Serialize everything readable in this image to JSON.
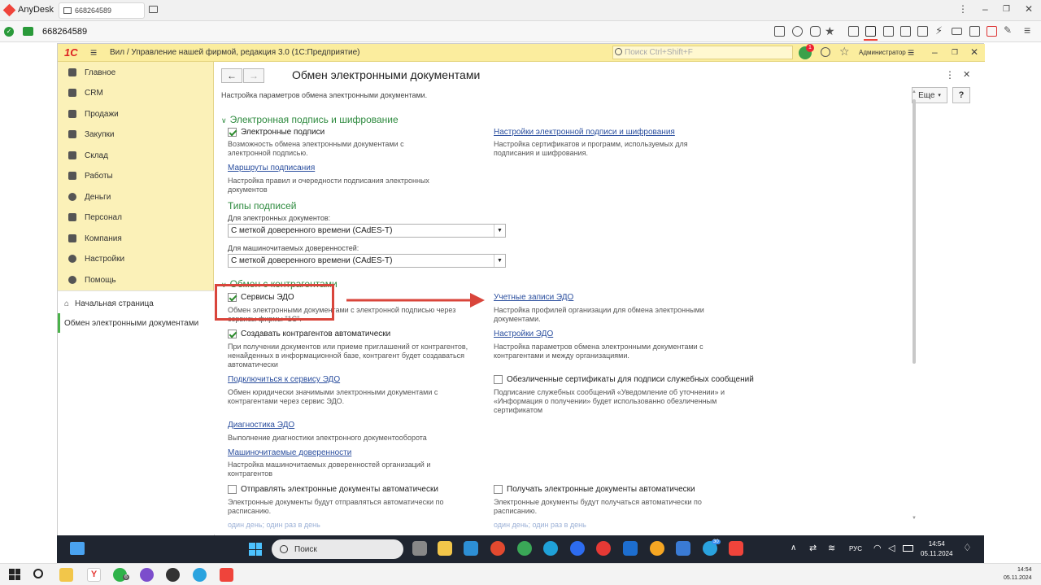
{
  "anydesk": {
    "app_name": "AnyDesk",
    "tab_id": "668264589",
    "session_id": "668264589",
    "accent_color": "#ef443b"
  },
  "onec": {
    "logo": "1С",
    "window_title": "Вил / Управление нашей фирмой, редакция 3.0  (1С:Предприятие)",
    "search_placeholder": "Поиск Ctrl+Shift+F",
    "notification_count": "1",
    "user": "Администратор"
  },
  "sidebar": {
    "items": [
      {
        "label": "Главное",
        "icon": "menu-icon"
      },
      {
        "label": "CRM",
        "icon": "crm-icon"
      },
      {
        "label": "Продажи",
        "icon": "sales-icon"
      },
      {
        "label": "Закупки",
        "icon": "cart-icon"
      },
      {
        "label": "Склад",
        "icon": "warehouse-icon"
      },
      {
        "label": "Работы",
        "icon": "tools-icon"
      },
      {
        "label": "Деньги",
        "icon": "money-icon"
      },
      {
        "label": "Персонал",
        "icon": "people-icon"
      },
      {
        "label": "Компания",
        "icon": "flag-icon"
      },
      {
        "label": "Настройки",
        "icon": "gear-icon"
      },
      {
        "label": "Помощь",
        "icon": "help-icon"
      }
    ],
    "home_link": "Начальная страница",
    "active_link": "Обмен электронными документами"
  },
  "form": {
    "title": "Обмен электронными документами",
    "description": "Настройка параметров обмена электронными документами.",
    "more_label": "Еще",
    "help_label": "?",
    "section1": {
      "title": "Электронная подпись и шифрование",
      "esig_checkbox": "Электронные подписи",
      "esig_desc": "Возможность обмена электронными документами с электронной подписью.",
      "esig_settings_link": "Настройки электронной подписи и шифрования",
      "esig_settings_desc": "Настройка сертификатов и программ, используемых для подписания и шифрования.",
      "routes_link": "Маршруты подписания",
      "routes_desc": "Настройка правил и очередности подписания электронных документов",
      "sig_types_title": "Типы подписей",
      "for_edocs_label": "Для электронных документов:",
      "for_edocs_value": "С меткой доверенного времени (CAdES-T)",
      "for_poa_label": "Для машиночитаемых доверенностей:",
      "for_poa_value": "С меткой доверенного времени (CAdES-T)"
    },
    "section2": {
      "title": "Обмен с контрагентами",
      "edo_services_checkbox": "Сервисы ЭДО",
      "edo_services_desc": "Обмен электронными документами с электронной подписью через сервисы фирмы \"1С\".",
      "accounts_link": "Учетные записи ЭДО",
      "accounts_desc": "Настройка профилей организации для обмена электронными документами.",
      "auto_contractors_checkbox": "Создавать контрагентов автоматически",
      "auto_contractors_desc": "При получении документов или приеме приглашений от контрагентов, ненайденных в информационной базе, контрагент будет создаваться автоматически",
      "edo_settings_link": "Настройки ЭДО",
      "edo_settings_desc": "Настройка параметров обмена электронными документами с контрагентами и между организациями.",
      "connect_link": "Подключиться к сервису ЭДО",
      "connect_desc": "Обмен юридически значимыми электронными документами с контрагентами через сервис ЭДО.",
      "impersonal_checkbox": "Обезличенные сертификаты для подписи служебных сообщений",
      "impersonal_desc": "Подписание служебных сообщений «Уведомление об уточнении» и «Информация о получении» будет использованно обезличенным сертификатом",
      "diagnostics_link": "Диагностика ЭДО",
      "diagnostics_desc": "Выполнение диагностики электронного документооборота",
      "mpoa_link": "Машиночитаемые доверенности",
      "mpoa_desc": "Настройка машиночитаемых доверенностей организаций и контрагентов",
      "auto_send_checkbox": "Отправлять электронные документы автоматически",
      "auto_send_desc": "Электронные документы будут отправляться автоматически по расписанию.",
      "auto_send_schedule": "один день; один раз в день",
      "auto_receive_checkbox": "Получать электронные документы автоматически",
      "auto_receive_desc": "Электронные документы будут получаться автоматически по расписанию.",
      "auto_receive_schedule": "один день; один раз в день"
    }
  },
  "taskbar": {
    "search_label": "Поиск",
    "lang": "РУС",
    "time": "14:54",
    "date": "05.11.2024",
    "telegram_badge": "30"
  },
  "localbar": {
    "time": "14:54",
    "date": "05.11.2024",
    "whatsapp_badge": "6"
  }
}
